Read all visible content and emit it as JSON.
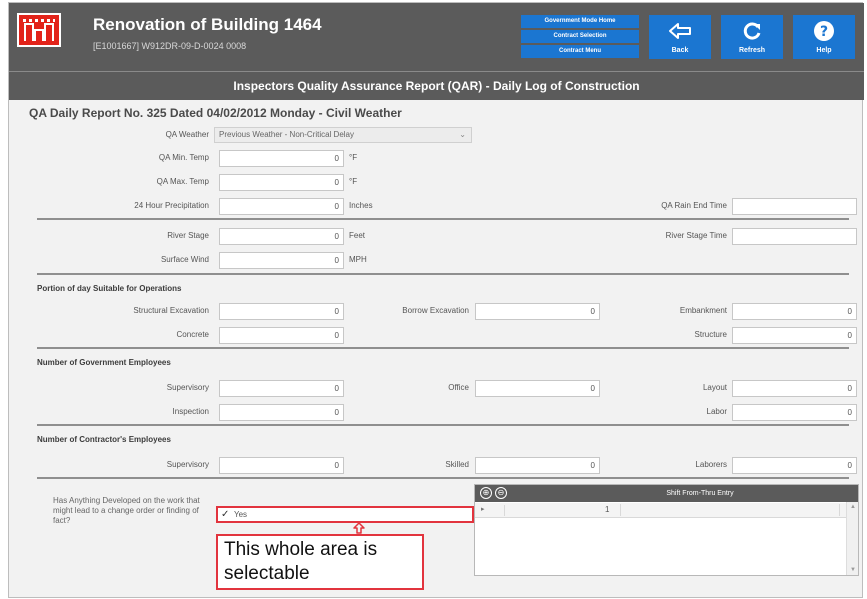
{
  "header": {
    "app_title": "Renovation of Building 1464",
    "contract_id": "[E1001667] W912DR-09-D-0024  0008",
    "nav_links": [
      "Government Mode Home",
      "Contract Selection",
      "Contract Menu"
    ],
    "back_label": "Back",
    "refresh_label": "Refresh",
    "help_label": "Help"
  },
  "banner": {
    "title": "Inspectors Quality Assurance Report (QAR) - Daily Log of Construction"
  },
  "report": {
    "title": "QA Daily Report No. 325 Dated 04/02/2012 Monday - Civil Weather",
    "qa_weather": {
      "label": "QA Weather",
      "value": "Previous Weather - Non-Critical Delay"
    },
    "min_temp": {
      "label": "QA Min. Temp",
      "value": "0",
      "unit": "°F"
    },
    "max_temp": {
      "label": "QA Max. Temp",
      "value": "0",
      "unit": "°F"
    },
    "precip": {
      "label": "24 Hour Precipitation",
      "value": "0",
      "unit": "Inches"
    },
    "rain_end": {
      "label": "QA Rain End Time",
      "value": ""
    },
    "river_stage": {
      "label": "River Stage",
      "value": "0",
      "unit": "Feet"
    },
    "river_stage_time": {
      "label": "River Stage Time",
      "value": ""
    },
    "surface_wind": {
      "label": "Surface Wind",
      "value": "0",
      "unit": "MPH"
    }
  },
  "portion": {
    "heading": "Portion of day Suitable for Operations",
    "structural_excavation": {
      "label": "Structural Excavation",
      "value": "0"
    },
    "borrow_excavation": {
      "label": "Borrow Excavation",
      "value": "0"
    },
    "embankment": {
      "label": "Embankment",
      "value": "0"
    },
    "concrete": {
      "label": "Concrete",
      "value": "0"
    },
    "structure": {
      "label": "Structure",
      "value": "0"
    }
  },
  "gov_employees": {
    "heading": "Number of Government Employees",
    "supervisory": {
      "label": "Supervisory",
      "value": "0"
    },
    "office": {
      "label": "Office",
      "value": "0"
    },
    "layout": {
      "label": "Layout",
      "value": "0"
    },
    "inspection": {
      "label": "Inspection",
      "value": "0"
    },
    "labor": {
      "label": "Labor",
      "value": "0"
    }
  },
  "contractor_employees": {
    "heading": "Number of Contractor's Employees",
    "supervisory": {
      "label": "Supervisory",
      "value": "0"
    },
    "skilled": {
      "label": "Skilled",
      "value": "0"
    },
    "laborers": {
      "label": "Laborers",
      "value": "0"
    }
  },
  "change_order": {
    "question": "Has Anything Developed on the work that might lead to a change order or finding of fact?",
    "checkbox_label": "Yes",
    "checked": true
  },
  "annotation": {
    "callout": "This whole area is selectable"
  },
  "shift_grid": {
    "header": "Shift From-Thru Entry",
    "row_value": "1"
  },
  "colors": {
    "header_bg": "#5b5b5b",
    "button_blue": "#1b76d1",
    "logo_red": "#e2231a",
    "annotation_red": "#e2343e"
  }
}
